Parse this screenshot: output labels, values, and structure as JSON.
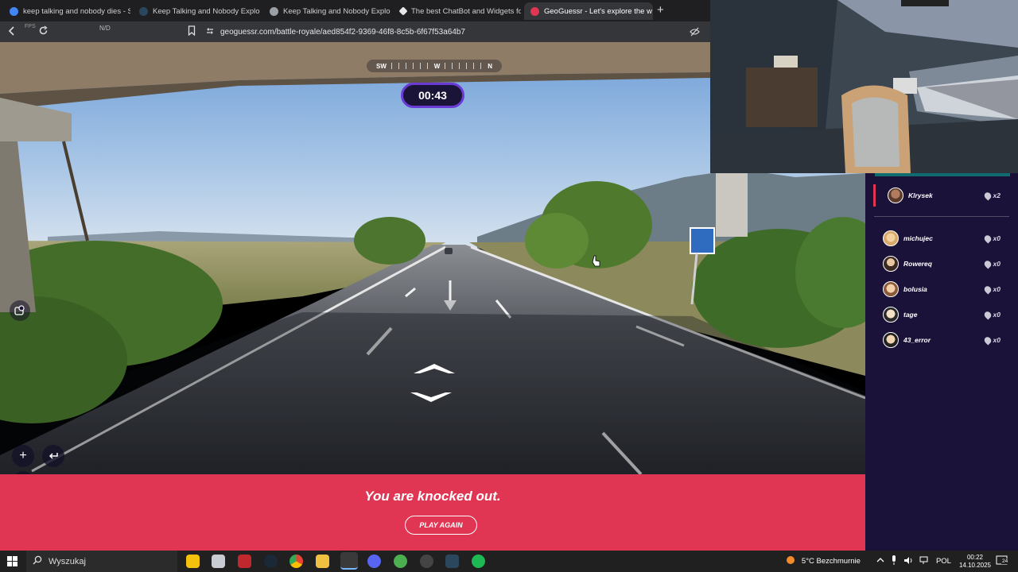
{
  "browser": {
    "tabs": [
      {
        "title": "keep talking and nobody dies - Szuk",
        "favicon_color": "#4285f4",
        "active": false
      },
      {
        "title": "Keep Talking and Nobody Explodes n",
        "favicon_color": "#1b2838",
        "active": false
      },
      {
        "title": "Keep Talking and Nobody Explodes",
        "favicon_color": "#ffffff",
        "active": false
      },
      {
        "title": "The best ChatBot and Widgets for Ki",
        "favicon_color": "#e6e6e6",
        "active": false
      },
      {
        "title": "GeoGuessr - Let's explore the w",
        "favicon_color": "#e03553",
        "active": true
      }
    ],
    "close_symbol": "✕",
    "new_tab_symbol": "+",
    "url": "geoguessr.com/battle-royale/aed854f2-9369-46f8-8c5b-6f67f53a64b7",
    "fps_label": "FPS",
    "nd_label": "N/D"
  },
  "game": {
    "compass": {
      "left": "SW",
      "center": "W",
      "right": "N"
    },
    "timer": "00:43",
    "knocked_out_text": "You are knocked out.",
    "play_again_label": "PLAY AGAIN"
  },
  "players": {
    "me": {
      "name": "Klrysek",
      "score": "x2"
    },
    "others": [
      {
        "name": "michujec",
        "score": "x0"
      },
      {
        "name": "Rowereq",
        "score": "x0"
      },
      {
        "name": "bolusia",
        "score": "x0"
      },
      {
        "name": "tage",
        "score": "x0"
      },
      {
        "name": "43_error",
        "score": "x0"
      }
    ]
  },
  "taskbar": {
    "search_placeholder": "Wyszukaj",
    "weather": "5°C  Bezchmurnie",
    "language": "POL",
    "time": "00:22",
    "date": "14.10.2025",
    "notification_count": "24"
  },
  "colors": {
    "accent_red": "#e03553",
    "panel_purple": "#1a1238",
    "timer_ring": "#6b3bd6"
  }
}
